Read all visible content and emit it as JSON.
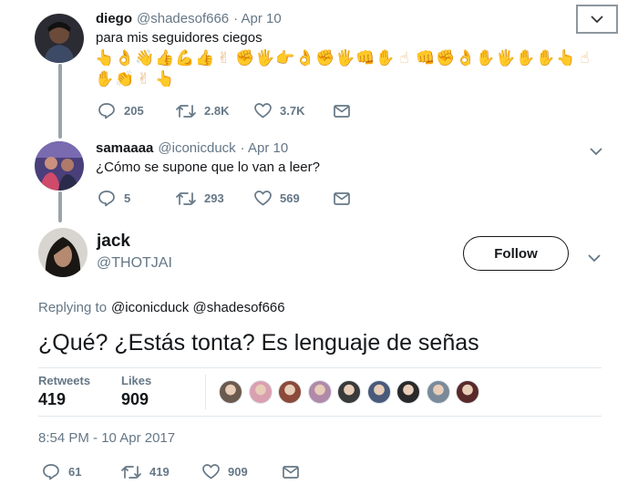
{
  "tweet1": {
    "name": "diego",
    "handle": "@shadesof666",
    "date": "· Apr 10",
    "text": "para mis seguidores ciegos",
    "emoji_row1": [
      "👆",
      "👌",
      "👋",
      "👍",
      "💪",
      "👍",
      "✌",
      "✊",
      "🖐",
      "👉",
      "👌",
      "✊",
      "🖐",
      "👊",
      "✋",
      "☝",
      "👊",
      "✊",
      "👌",
      "✋",
      "🖐",
      "✋",
      "✋",
      "👆",
      "☝"
    ],
    "emoji_row2": [
      "✋",
      "👏",
      "✌",
      "👆"
    ],
    "replies": "205",
    "retweets": "2.8K",
    "likes": "3.7K"
  },
  "tweet2": {
    "name": "samaaaa",
    "handle": "@iconicduck",
    "date": "· Apr 10",
    "text": "¿Cómo se supone que lo van a leer?",
    "replies": "5",
    "retweets": "293",
    "likes": "569"
  },
  "tweet3": {
    "name": "jack",
    "handle": "@THOTJAI",
    "follow_label": "Follow",
    "replying_label": "Replying to",
    "replying_to": "@iconicduck @shadesof666",
    "text": "¿Qué? ¿Estás tonta? Es lenguaje de señas",
    "retweets_label": "Retweets",
    "retweets_count": "419",
    "likes_label": "Likes",
    "likes_count": "909",
    "timestamp": "8:54 PM - 10 Apr 2017",
    "replies": "61",
    "retweets": "419",
    "likes": "909"
  },
  "colors": {
    "muted": "#657786",
    "text": "#14171a",
    "emoji": "#e9b57c",
    "thread_line": "#9aa4ad"
  },
  "likers": [
    "#6b5a4e",
    "#d9a0b0",
    "#8c4a3a",
    "#b08aa8",
    "#3a3a3a",
    "#4a5a7a",
    "#2a2a2a",
    "#7a8a9a",
    "#5a2a2a"
  ]
}
